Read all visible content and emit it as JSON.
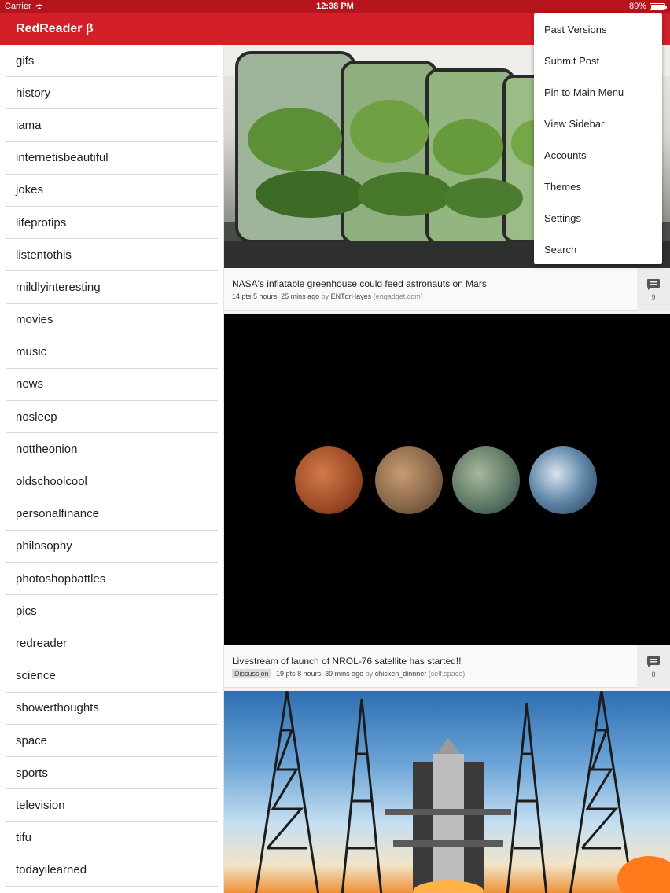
{
  "status": {
    "carrier": "Carrier",
    "time": "12:38 PM",
    "battery": "89%",
    "battery_level": 0.89
  },
  "app": {
    "title": "RedReader β"
  },
  "sidebar": {
    "items": [
      "gifs",
      "history",
      "iama",
      "internetisbeautiful",
      "jokes",
      "lifeprotips",
      "listentothis",
      "mildlyinteresting",
      "movies",
      "music",
      "news",
      "nosleep",
      "nottheonion",
      "oldschoolcool",
      "personalfinance",
      "philosophy",
      "photoshopbattles",
      "pics",
      "redreader",
      "science",
      "showerthoughts",
      "space",
      "sports",
      "television",
      "tifu",
      "todayilearned"
    ]
  },
  "posts": [
    {
      "title": "NASA's inflatable greenhouse could feed astronauts on Mars",
      "points": "14 pts",
      "age": "5 hours, 25 mins ago",
      "by": "by",
      "author": "ENTdrHayes",
      "domain": "(engadget.com)",
      "comments": "9"
    },
    {
      "title": "Livestream of launch of NROL-76 satellite has started!!",
      "flair": "Discussion",
      "points": "19 pts",
      "age": "8 hours, 39 mins ago",
      "by": "by",
      "author": "chicken_dinnner",
      "domain": "(self.space)",
      "comments": "8"
    }
  ],
  "menu": {
    "items": [
      "Past Versions",
      "Submit Post",
      "Pin to Main Menu",
      "View Sidebar",
      "Accounts",
      "Themes",
      "Settings",
      "Search"
    ]
  },
  "colors": {
    "statusbar": "#b5141c",
    "appbar": "#d32028"
  }
}
